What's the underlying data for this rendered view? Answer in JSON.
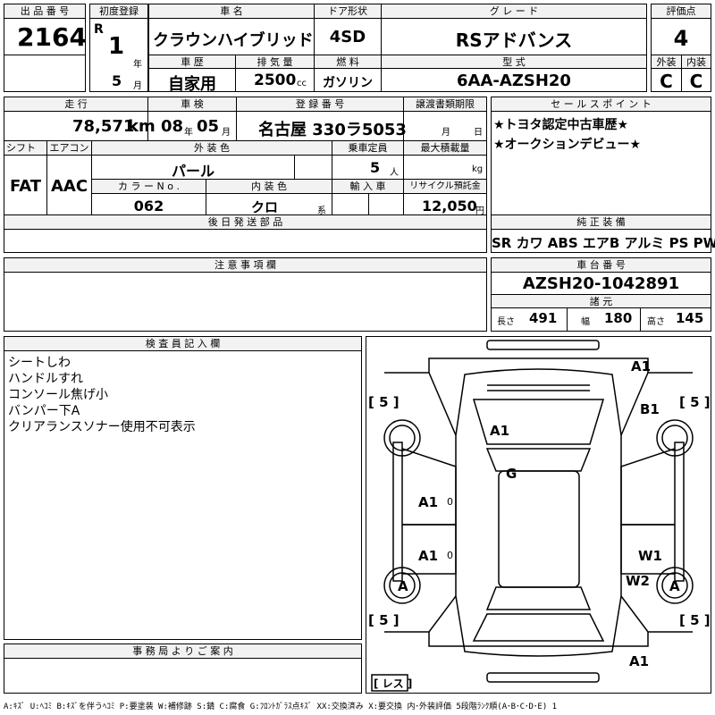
{
  "labels": {
    "lot_no": "出 品 番 号",
    "first_reg": "初度登録",
    "car_name": "車 名",
    "door": "ドア形状",
    "grade": "グ レ ー ド",
    "score": "評価点",
    "history": "車 歴",
    "displacement": "排 気 量",
    "fuel": "燃 料",
    "model_code": "型 式",
    "exterior": "外装",
    "interior": "内装",
    "mileage": "走 行",
    "inspection": "車 検",
    "reg_no": "登 録 番 号",
    "transfer_deadline": "譲渡書類期限",
    "sales_points": "セ ー ル ス ポ イ ン ト",
    "shift": "シフト",
    "aircon": "エアコン",
    "ext_color": "外 装 色",
    "capacity": "乗車定員",
    "max_load": "最大積載量",
    "color_no": "カ ラ ー N o .",
    "int_color": "内 装 色",
    "import": "輸 入 車",
    "recycle": "リサイクル預託金",
    "later_parts": "後 日 発 送 部 品",
    "genuine_equipment": "純 正 装 備",
    "notes": "注 意 事 項 欄",
    "chassis_no": "車 台 番 号",
    "specs": "諸 元",
    "inspector_notes": "検 査 員 記 入 欄",
    "office_notes": "事 務 局 よ り ご 案 内",
    "unit_year": "年",
    "unit_month": "月",
    "unit_cc": "cc",
    "unit_km": "km",
    "unit_person": "人",
    "unit_kg": "kg",
    "unit_yen": "円",
    "unit_kei": "系",
    "length": "長さ",
    "width": "幅",
    "height": "高さ"
  },
  "values": {
    "lot_no": "2164",
    "era": "R",
    "year": "1",
    "month": "5",
    "car_name": "クラウンハイブリッド",
    "door": "4SD",
    "grade": "RSアドバンス",
    "score": "4",
    "history": "自家用",
    "displacement": "2500",
    "fuel": "ガソリン",
    "model_code": "6AA-AZSH20",
    "exterior": "C",
    "interior": "C",
    "mileage": "78,571",
    "insp_year": "08",
    "insp_month": "05",
    "reg_no": "名古屋 330ラ5053",
    "transfer_month_label": "月",
    "transfer_day_label": "日",
    "shift": "FAT",
    "aircon": "AAC",
    "ext_color": "パール",
    "capacity": "5",
    "color_no": "062",
    "int_color": "クロ",
    "recycle": "12,050",
    "genuine_equipment": "SR カワ ABS エアB アルミ PS PW",
    "chassis_no": "AZSH20-1042891",
    "length": "491",
    "width": "180",
    "height": "145"
  },
  "sales_points": [
    "★トヨタ認定中古車歴★",
    "★オークションデビュー★"
  ],
  "inspector_notes": [
    "シートしわ",
    "ハンドルすれ",
    "コンソール焦げ小",
    "バンパー下A",
    "クリアランスソナー使用不可表示"
  ],
  "diagram_marks": {
    "front_bumper": "A1",
    "hood": "A1",
    "roof": "G",
    "left_front_door": "A1",
    "left_rear_door": "A1",
    "right_front_fender": "B1",
    "right_rear_door": "W1",
    "right_rear_fender": "W2",
    "left_rear_wheel": "A",
    "right_rear_wheel": "A",
    "rear_bumper": "A1",
    "tire_fl": "[ 5 ]",
    "tire_fr": "[ 5 ]",
    "tire_rl": "[ 5 ]",
    "tire_rr": "[ 5 ]",
    "spare": "[ レス ]",
    "zero_left_front": "0",
    "zero_left_rear": "0"
  },
  "legend": "A:ｷｽﾞ U:ﾍｺﾐ B:ｷｽﾞを伴うﾍｺﾐ P:要塗装 W:補修跡 S:錆 C:腐食 G:ﾌﾛﾝﾄｶﾞﾗｽ点ｷｽﾞ XX:交換済み X:要交換 内･外装評価 5段階ﾗﾝｸ順(A･B･C･D･E) 1"
}
